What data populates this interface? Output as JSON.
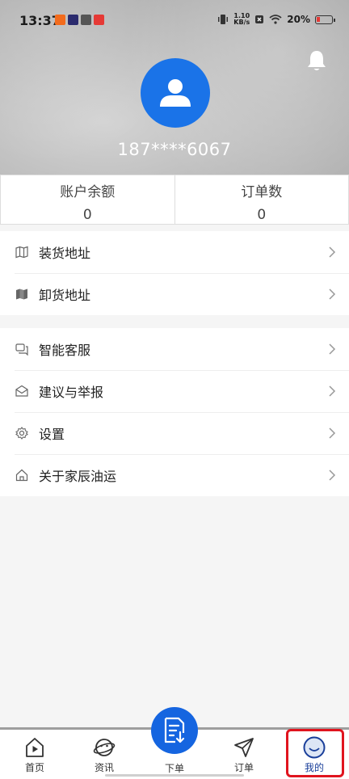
{
  "status_bar": {
    "time": "13:37",
    "speed_value": "1.10",
    "speed_unit": "KB/s",
    "battery": "20%"
  },
  "profile": {
    "phone": "187****6067"
  },
  "stats": [
    {
      "label": "账户余额",
      "value": "0"
    },
    {
      "label": "订单数",
      "value": "0"
    }
  ],
  "menu_group1": [
    {
      "label": "装货地址",
      "icon": "map-icon"
    },
    {
      "label": "卸货地址",
      "icon": "map-filled-icon"
    }
  ],
  "menu_group2": [
    {
      "label": "智能客服",
      "icon": "chat-icon"
    },
    {
      "label": "建议与举报",
      "icon": "mail-icon"
    },
    {
      "label": "设置",
      "icon": "gear-icon"
    },
    {
      "label": "关于家辰油运",
      "icon": "home-icon"
    }
  ],
  "nav": {
    "home": "首页",
    "news": "资讯",
    "order_create": "下单",
    "orders": "订单",
    "mine": "我的"
  },
  "colors": {
    "accent": "#1a73e8",
    "highlight": "#e0141e"
  }
}
